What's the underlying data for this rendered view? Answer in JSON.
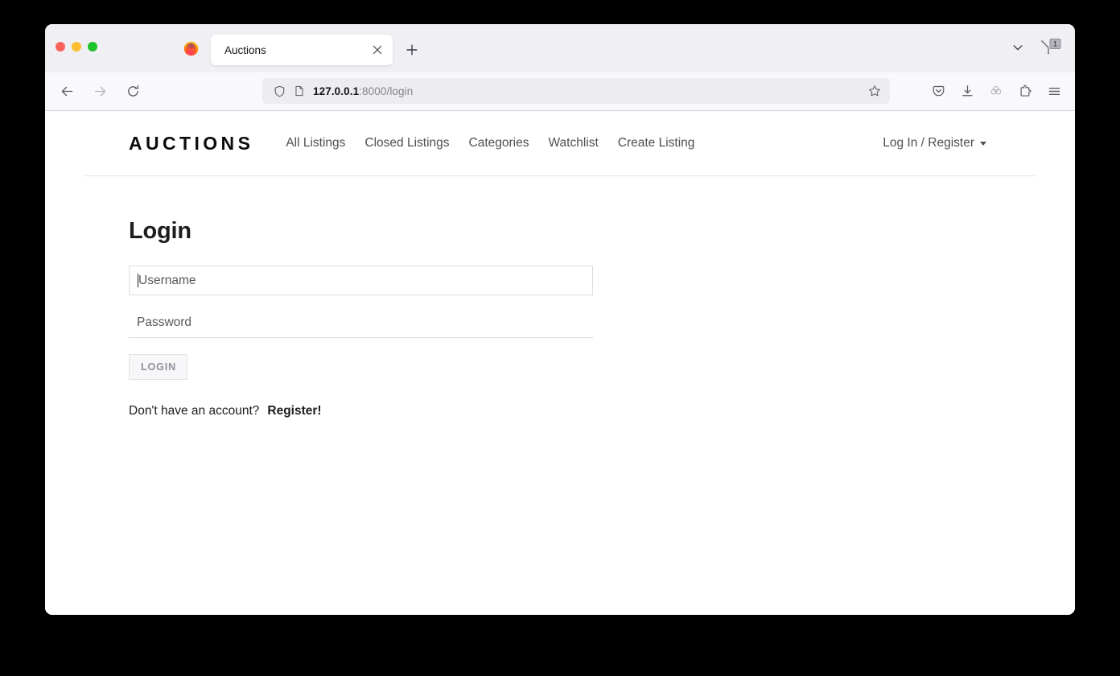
{
  "browser": {
    "window_controls": [
      "close",
      "minimize",
      "maximize"
    ],
    "app_icon": "firefox-logo",
    "tabs": [
      {
        "title": "Auctions",
        "active": true,
        "close_icon": "close-icon"
      }
    ],
    "new_tab_label": "+",
    "tabstrip_right": {
      "list_all_tabs_icon": "chevron-down-icon",
      "workspace_badge": "1"
    },
    "toolbar": {
      "back_icon": "back-arrow-icon",
      "forward_icon": "forward-arrow-icon",
      "reload_icon": "reload-icon",
      "shield_icon": "shield-icon",
      "page_icon": "page-document-icon",
      "url_host": "127.0.0.1",
      "url_rest": ":8000/login",
      "url_full": "127.0.0.1:8000/login",
      "bookmark_icon": "star-icon",
      "right_icons": [
        "pocket-save-icon",
        "download-icon",
        "containers-icon",
        "extensions-puzzle-icon",
        "hamburger-menu-icon"
      ]
    }
  },
  "site": {
    "brand": "AUCTIONS",
    "nav_links": [
      {
        "label": "All Listings"
      },
      {
        "label": "Closed Listings"
      },
      {
        "label": "Categories"
      },
      {
        "label": "Watchlist"
      },
      {
        "label": "Create Listing"
      }
    ],
    "account_menu": {
      "label": "Log In / Register",
      "caret_icon": "caret-down-icon"
    }
  },
  "page": {
    "title": "Login",
    "form": {
      "username": {
        "placeholder": "Username",
        "value": "",
        "focused": true
      },
      "password": {
        "placeholder": "Password",
        "value": "",
        "focused": false
      },
      "submit_label": "LOGIN"
    },
    "register_prompt": "Don't have an account?",
    "register_link": "Register!"
  },
  "colors": {
    "page_background": "#ffffff",
    "tabstrip_background": "#f0eff4",
    "toolbar_background": "#f9f9fb",
    "urlbar_background": "#ededf0",
    "nav_link_text": "#4f4f4f",
    "heading_text": "#1d1d21",
    "field_border": "#dcdcdc",
    "button_background": "#f7f7f9",
    "button_text": "#8d8f9a",
    "divider": "#e6e6e6",
    "desktop_background": "#000000"
  }
}
